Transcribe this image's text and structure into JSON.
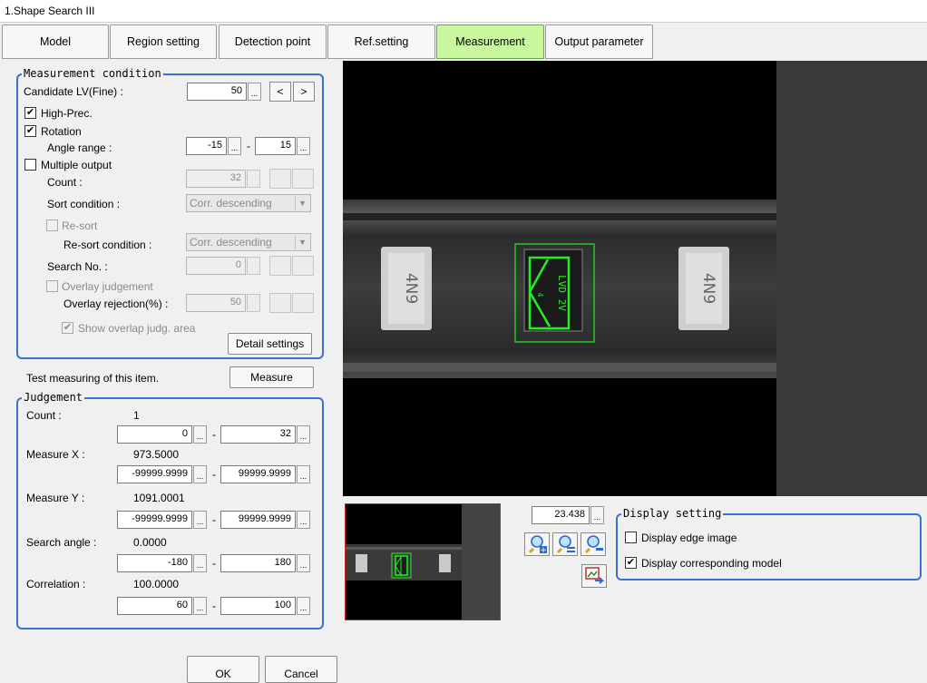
{
  "window": {
    "title": "1.Shape Search III"
  },
  "tabs": [
    {
      "label": "Model"
    },
    {
      "label": "Region setting"
    },
    {
      "label": "Detection point"
    },
    {
      "label": "Ref.setting"
    },
    {
      "label": "Measurement",
      "active": true
    },
    {
      "label": "Output parameter"
    }
  ],
  "measurement": {
    "title": "Measurement condition",
    "candidate_label": "Candidate LV(Fine) :",
    "candidate_value": "50",
    "prev_label": "<",
    "next_label": ">",
    "high_prec_label": "High-Prec.",
    "high_prec_checked": true,
    "rotation_label": "Rotation",
    "rotation_checked": true,
    "angle_label": "Angle range :",
    "angle_min": "-15",
    "angle_max": "15",
    "multiple_label": "Multiple output",
    "multiple_checked": false,
    "count_label": "Count :",
    "count_value": "32",
    "sort_label": "Sort condition :",
    "sort_value": "Corr. descending",
    "resort_label": "Re-sort",
    "resort_condition_label": "Re-sort condition :",
    "resort_value": "Corr. descending",
    "search_no_label": "Search No. :",
    "search_no_value": "0",
    "overlay_label": "Overlay judgement",
    "overlay_rejection_label": "Overlay rejection(%) :",
    "overlay_rejection_value": "50",
    "show_overlap_label": "Show overlap judg. area",
    "show_overlap_checked": true,
    "detail_button": "Detail settings",
    "dots": "..."
  },
  "test": {
    "label": "Test measuring of this item.",
    "button": "Measure"
  },
  "judgement": {
    "title": "Judgement",
    "count": {
      "label": "Count :",
      "value": "1",
      "min": "0",
      "max": "32"
    },
    "measure_x": {
      "label": "Measure X :",
      "value": "973.5000",
      "min": "-99999.9999",
      "max": "99999.9999"
    },
    "measure_y": {
      "label": "Measure Y :",
      "value": "1091.0001",
      "min": "-99999.9999",
      "max": "99999.9999"
    },
    "search_angle": {
      "label": "Search angle :",
      "value": "0.0000",
      "min": "-180",
      "max": "180"
    },
    "correlation": {
      "label": "Correlation :",
      "value": "100.0000",
      "min": "60",
      "max": "100"
    },
    "dash": "-"
  },
  "footer": {
    "ok": "OK",
    "cancel": "Cancel"
  },
  "zoom": {
    "value": "23.438"
  },
  "display_setting": {
    "title": "Display setting",
    "edge_label": "Display edge image",
    "edge_checked": false,
    "model_label": "Display corresponding model",
    "model_checked": true
  },
  "icons": {
    "zoom_in": "zoom-in-icon",
    "zoom_fit": "zoom-fit-icon",
    "zoom_out": "zoom-out-icon",
    "image_swap": "image-swap-icon"
  },
  "colors": {
    "accent_blue": "#3b6fd0",
    "active_tab": "#c8f7a0",
    "detection_green": "#22ee22",
    "thumb_border": "#cc2222"
  }
}
